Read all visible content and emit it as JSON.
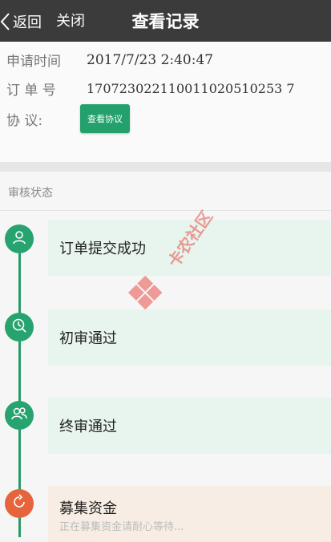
{
  "header": {
    "back_label": "返回",
    "close_label": "关闭",
    "title": "查看记录"
  },
  "info": {
    "apply_time_label": "申请时间",
    "apply_time_value": "2017/7/23 2:40:47",
    "order_no_label": "订 单 号",
    "order_no_value": "170723022110011020510253 7",
    "protocol_label": "协 议:",
    "protocol_button": "查看协议"
  },
  "status": {
    "section_label": "审核状态",
    "steps": [
      {
        "title": "订单提交成功",
        "subtitle": "",
        "icon": "user-icon",
        "color": "#27a36f"
      },
      {
        "title": "初审通过",
        "subtitle": "",
        "icon": "clock-icon",
        "color": "#27a36f"
      },
      {
        "title": "终审通过",
        "subtitle": "",
        "icon": "users-icon",
        "color": "#27a36f"
      },
      {
        "title": "募集资金",
        "subtitle": "正在募集资金请耐心等待...",
        "icon": "refresh-icon",
        "color": "#e6643b"
      }
    ]
  },
  "watermark": "卡农社区",
  "colors": {
    "accent": "#27a36f",
    "header_bg": "#3b3b3b",
    "pending": "#e6643b"
  }
}
